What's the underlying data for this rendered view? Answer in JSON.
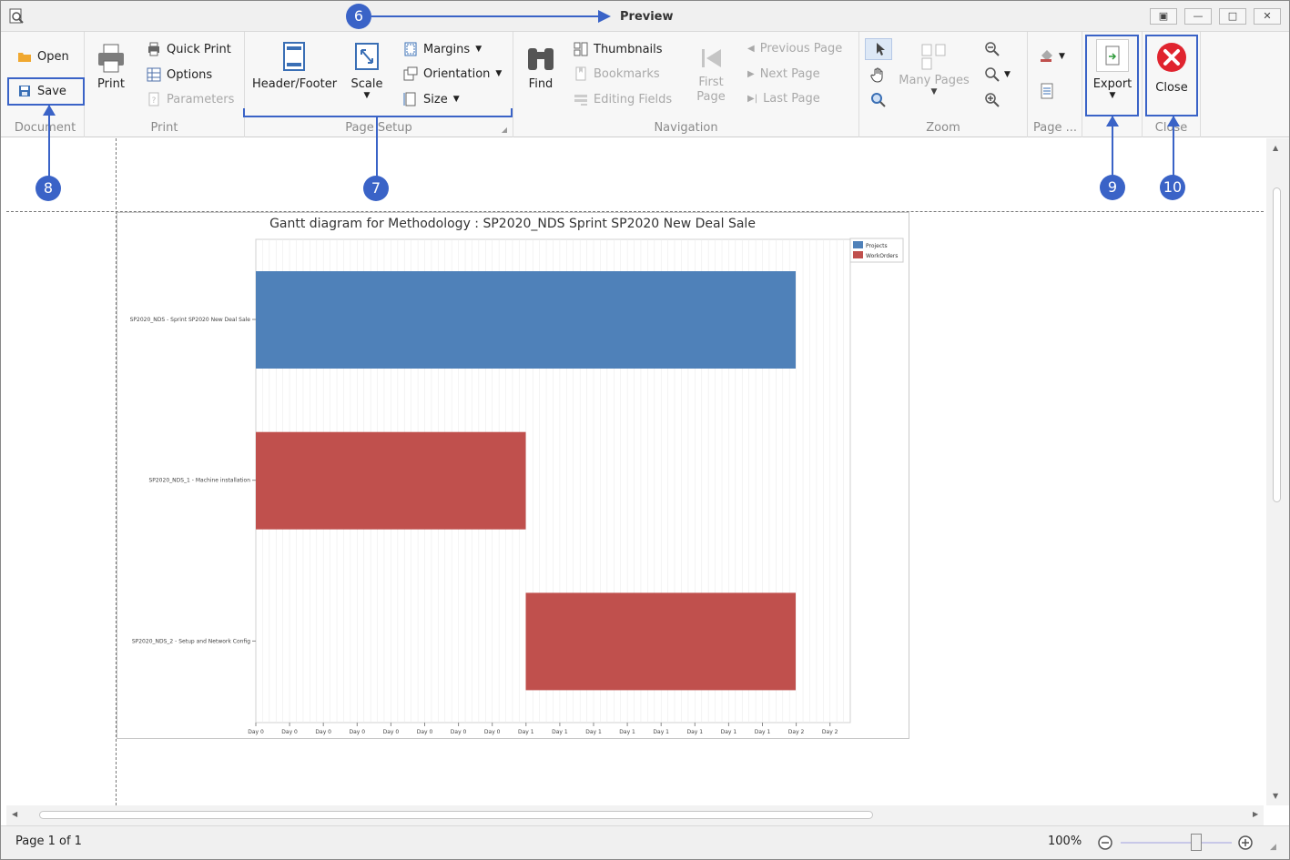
{
  "window": {
    "title": "Preview"
  },
  "ribbon": {
    "document": {
      "caption": "Document",
      "open": "Open",
      "save": "Save"
    },
    "print": {
      "caption": "Print",
      "print": "Print",
      "quick_print": "Quick Print",
      "options": "Options",
      "parameters": "Parameters"
    },
    "page_setup": {
      "caption": "Page Setup",
      "header_footer": "Header/Footer",
      "scale": "Scale",
      "margins": "Margins",
      "orientation": "Orientation",
      "size": "Size"
    },
    "navigation": {
      "caption": "Navigation",
      "find": "Find",
      "thumbnails": "Thumbnails",
      "bookmarks": "Bookmarks",
      "editing_fields": "Editing Fields",
      "first_page": "First Page",
      "previous_page": "Previous Page",
      "next_page": "Next Page",
      "last_page": "Last Page"
    },
    "zoom": {
      "caption": "Zoom",
      "many_pages": "Many Pages"
    },
    "page_background": {
      "caption": "Page ..."
    },
    "export": {
      "caption": "",
      "export": "Export"
    },
    "close": {
      "caption": "Close",
      "close": "Close"
    }
  },
  "annotations": [
    "6",
    "7",
    "8",
    "9",
    "10"
  ],
  "status": {
    "page": "Page 1 of 1",
    "zoom": "100%",
    "zoom_fraction": 0.68
  },
  "colors": {
    "accent": "#3a63c7",
    "projects": "#4f81b9",
    "workorders": "#c0504d",
    "close_red": "#e0242f"
  },
  "chart_data": {
    "type": "gantt",
    "title": "Gantt diagram for Methodology : SP2020_NDS Sprint SP2020 New Deal Sale",
    "categories": [
      "SP2020_NDS - Sprint SP2020 New Deal Sale",
      "SP2020_NDS_1 - Machine installation",
      "SP2020_NDS_2 - Setup and Network Config"
    ],
    "x_ticks": [
      "Day 0",
      "Day 0",
      "Day 0",
      "Day 0",
      "Day 0",
      "Day 0",
      "Day 0",
      "Day 0",
      "Day 1",
      "Day 1",
      "Day 1",
      "Day 1",
      "Day 1",
      "Day 1",
      "Day 1",
      "Day 1",
      "Day 2",
      "Day 2"
    ],
    "xlim": [
      0,
      2.2
    ],
    "bars": [
      {
        "category": 0,
        "series": 0,
        "start": 0,
        "end": 2
      },
      {
        "category": 1,
        "series": 1,
        "start": 0,
        "end": 1
      },
      {
        "category": 2,
        "series": 1,
        "start": 1,
        "end": 2
      }
    ],
    "series": [
      {
        "name": "Projects",
        "color": "#4f81b9"
      },
      {
        "name": "WorkOrders",
        "color": "#c0504d"
      }
    ],
    "legend": "top-right"
  }
}
